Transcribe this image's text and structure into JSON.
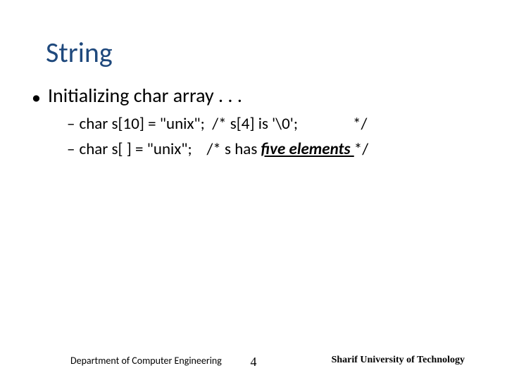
{
  "title": "String",
  "bullet1": "Initializing char array . . .",
  "line1_code": "char s[10] = \"unix\";",
  "line1_comment_open": "/* s[4] is '\\0';",
  "line1_comment_close": "*/",
  "line2_code": "char s[ ] = \"unix\";",
  "line2_comment_open": "/* s has ",
  "line2_stress": "five elements ",
  "line2_comment_close": "*/",
  "footer_left": "Department of Computer Engineering",
  "page_number": "4",
  "footer_right": "Sharif University of Technology"
}
